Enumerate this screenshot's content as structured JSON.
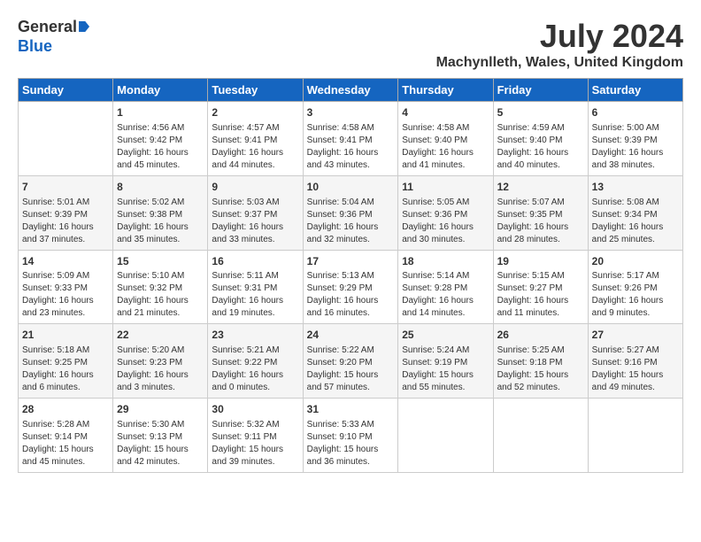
{
  "logo": {
    "line1": "General",
    "line2": "Blue"
  },
  "title": "July 2024",
  "subtitle": "Machynlleth, Wales, United Kingdom",
  "days_of_week": [
    "Sunday",
    "Monday",
    "Tuesday",
    "Wednesday",
    "Thursday",
    "Friday",
    "Saturday"
  ],
  "weeks": [
    [
      {
        "day": "",
        "info": ""
      },
      {
        "day": "1",
        "info": "Sunrise: 4:56 AM\nSunset: 9:42 PM\nDaylight: 16 hours\nand 45 minutes."
      },
      {
        "day": "2",
        "info": "Sunrise: 4:57 AM\nSunset: 9:41 PM\nDaylight: 16 hours\nand 44 minutes."
      },
      {
        "day": "3",
        "info": "Sunrise: 4:58 AM\nSunset: 9:41 PM\nDaylight: 16 hours\nand 43 minutes."
      },
      {
        "day": "4",
        "info": "Sunrise: 4:58 AM\nSunset: 9:40 PM\nDaylight: 16 hours\nand 41 minutes."
      },
      {
        "day": "5",
        "info": "Sunrise: 4:59 AM\nSunset: 9:40 PM\nDaylight: 16 hours\nand 40 minutes."
      },
      {
        "day": "6",
        "info": "Sunrise: 5:00 AM\nSunset: 9:39 PM\nDaylight: 16 hours\nand 38 minutes."
      }
    ],
    [
      {
        "day": "7",
        "info": "Sunrise: 5:01 AM\nSunset: 9:39 PM\nDaylight: 16 hours\nand 37 minutes."
      },
      {
        "day": "8",
        "info": "Sunrise: 5:02 AM\nSunset: 9:38 PM\nDaylight: 16 hours\nand 35 minutes."
      },
      {
        "day": "9",
        "info": "Sunrise: 5:03 AM\nSunset: 9:37 PM\nDaylight: 16 hours\nand 33 minutes."
      },
      {
        "day": "10",
        "info": "Sunrise: 5:04 AM\nSunset: 9:36 PM\nDaylight: 16 hours\nand 32 minutes."
      },
      {
        "day": "11",
        "info": "Sunrise: 5:05 AM\nSunset: 9:36 PM\nDaylight: 16 hours\nand 30 minutes."
      },
      {
        "day": "12",
        "info": "Sunrise: 5:07 AM\nSunset: 9:35 PM\nDaylight: 16 hours\nand 28 minutes."
      },
      {
        "day": "13",
        "info": "Sunrise: 5:08 AM\nSunset: 9:34 PM\nDaylight: 16 hours\nand 25 minutes."
      }
    ],
    [
      {
        "day": "14",
        "info": "Sunrise: 5:09 AM\nSunset: 9:33 PM\nDaylight: 16 hours\nand 23 minutes."
      },
      {
        "day": "15",
        "info": "Sunrise: 5:10 AM\nSunset: 9:32 PM\nDaylight: 16 hours\nand 21 minutes."
      },
      {
        "day": "16",
        "info": "Sunrise: 5:11 AM\nSunset: 9:31 PM\nDaylight: 16 hours\nand 19 minutes."
      },
      {
        "day": "17",
        "info": "Sunrise: 5:13 AM\nSunset: 9:29 PM\nDaylight: 16 hours\nand 16 minutes."
      },
      {
        "day": "18",
        "info": "Sunrise: 5:14 AM\nSunset: 9:28 PM\nDaylight: 16 hours\nand 14 minutes."
      },
      {
        "day": "19",
        "info": "Sunrise: 5:15 AM\nSunset: 9:27 PM\nDaylight: 16 hours\nand 11 minutes."
      },
      {
        "day": "20",
        "info": "Sunrise: 5:17 AM\nSunset: 9:26 PM\nDaylight: 16 hours\nand 9 minutes."
      }
    ],
    [
      {
        "day": "21",
        "info": "Sunrise: 5:18 AM\nSunset: 9:25 PM\nDaylight: 16 hours\nand 6 minutes."
      },
      {
        "day": "22",
        "info": "Sunrise: 5:20 AM\nSunset: 9:23 PM\nDaylight: 16 hours\nand 3 minutes."
      },
      {
        "day": "23",
        "info": "Sunrise: 5:21 AM\nSunset: 9:22 PM\nDaylight: 16 hours\nand 0 minutes."
      },
      {
        "day": "24",
        "info": "Sunrise: 5:22 AM\nSunset: 9:20 PM\nDaylight: 15 hours\nand 57 minutes."
      },
      {
        "day": "25",
        "info": "Sunrise: 5:24 AM\nSunset: 9:19 PM\nDaylight: 15 hours\nand 55 minutes."
      },
      {
        "day": "26",
        "info": "Sunrise: 5:25 AM\nSunset: 9:18 PM\nDaylight: 15 hours\nand 52 minutes."
      },
      {
        "day": "27",
        "info": "Sunrise: 5:27 AM\nSunset: 9:16 PM\nDaylight: 15 hours\nand 49 minutes."
      }
    ],
    [
      {
        "day": "28",
        "info": "Sunrise: 5:28 AM\nSunset: 9:14 PM\nDaylight: 15 hours\nand 45 minutes."
      },
      {
        "day": "29",
        "info": "Sunrise: 5:30 AM\nSunset: 9:13 PM\nDaylight: 15 hours\nand 42 minutes."
      },
      {
        "day": "30",
        "info": "Sunrise: 5:32 AM\nSunset: 9:11 PM\nDaylight: 15 hours\nand 39 minutes."
      },
      {
        "day": "31",
        "info": "Sunrise: 5:33 AM\nSunset: 9:10 PM\nDaylight: 15 hours\nand 36 minutes."
      },
      {
        "day": "",
        "info": ""
      },
      {
        "day": "",
        "info": ""
      },
      {
        "day": "",
        "info": ""
      }
    ]
  ]
}
